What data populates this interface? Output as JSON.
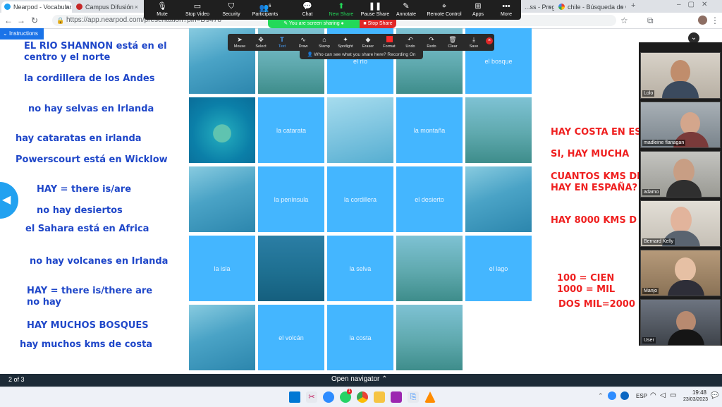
{
  "browser": {
    "tabs": [
      {
        "label": "Nearpod - Vocabular...",
        "close": "×"
      },
      {
        "label": "Campus Difusión",
        "close": "×"
      },
      {
        "label": "...ss - Pregu",
        "close": "×"
      },
      {
        "label": "chile - Búsqueda de G",
        "close": "×"
      }
    ],
    "url": "https://app.nearpod.com/presentation?pin=D9478"
  },
  "zoom_toolbar": {
    "buttons": [
      {
        "label": "Mute",
        "icon": "microphone-icon"
      },
      {
        "label": "Stop Video",
        "icon": "video-icon"
      },
      {
        "label": "Security",
        "icon": "shield-icon"
      },
      {
        "label": "Participants",
        "icon": "participants-icon",
        "count": "6"
      },
      {
        "label": "Chat",
        "icon": "chat-icon"
      },
      {
        "label": "New Share",
        "icon": "share-icon"
      },
      {
        "label": "Pause Share",
        "icon": "pause-icon"
      },
      {
        "label": "Annotate",
        "icon": "pen-icon"
      },
      {
        "label": "Remote Control",
        "icon": "mouse-icon"
      },
      {
        "label": "Apps",
        "icon": "apps-icon"
      },
      {
        "label": "More",
        "icon": "more-icon"
      }
    ],
    "sharing_status": "You are screen sharing",
    "stop_share": "Stop Share"
  },
  "annotate_toolbar": {
    "tools": [
      "Mouse",
      "Select",
      "Text",
      "Draw",
      "Stamp",
      "Spotlight",
      "Eraser",
      "Format",
      "Undo",
      "Redo",
      "Clear",
      "Save"
    ],
    "who_can_see": "Who can see what you share here? Recording On"
  },
  "nearpod": {
    "instructions": "Instructions",
    "left_notes": [
      "EL RIO SHANNON está en el",
      "centro y el norte",
      "la cordillera de los Andes",
      "no hay selvas en Irlanda",
      "hay cataratas en irlanda",
      "Powerscourt está en Wicklow",
      "HAY = there is/are",
      "no hay desiertos",
      "el Sahara está en Africa",
      "no hay volcanes en Irlanda",
      "HAY = there is/there are",
      "no hay",
      "HAY MUCHOS BOSQUES",
      "hay muchos kms de costa"
    ],
    "right_notes": [
      "HAY COSTA EN ES",
      "SI, HAY MUCHA",
      "CUANTOS KMS DE",
      "HAY EN ESPAÑA?",
      "HAY   8000 KMS D",
      "100 = CIEN",
      "1000 = MIL",
      "DOS MIL=2000"
    ],
    "cards": [
      "",
      "",
      "el río",
      "",
      "el bosque",
      "",
      "la catarata",
      "",
      "la montaña",
      "",
      "",
      "la península",
      "la cordillera",
      "el desierto",
      "",
      "la isla",
      "",
      "la selva",
      "",
      "el lago",
      "",
      "el volcán",
      "la costa",
      ""
    ],
    "page": "2 of 3",
    "navigator": "Open navigator"
  },
  "gallery": {
    "participants": [
      "Lolo",
      "madleine flanagan",
      "adamo",
      "Bernard Kelly",
      "Manjo",
      "User"
    ]
  },
  "taskbar": {
    "lang": "ESP",
    "time": "19:48",
    "date": "23/03/2023",
    "badge": "1"
  },
  "colors": {
    "card": "#44b6ff",
    "note_blue": "#1f47c9",
    "note_red": "#ef2020",
    "zoom_bg": "#1f1f1f",
    "share_green": "#23d959",
    "stop_red": "#e02828"
  }
}
